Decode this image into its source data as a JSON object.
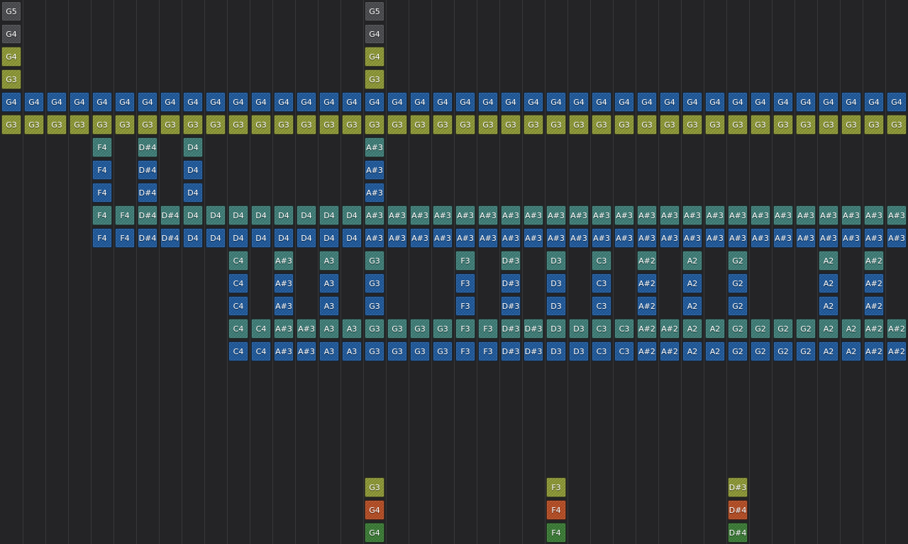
{
  "colors": {
    "background": "#242426",
    "grid_line": "#38383a",
    "blue": "#1f5a9e",
    "yellow": "#8f9a36",
    "teal": "#3f7f79",
    "gray": "#4a4b4f",
    "orange": "#b84e24",
    "green": "#3b7d36"
  },
  "columns": 40,
  "rows": 24,
  "runs": [
    {
      "row": 0,
      "start": 0,
      "color": "gray",
      "labels": [
        "G5"
      ]
    },
    {
      "row": 0,
      "start": 16,
      "color": "gray",
      "labels": [
        "G5"
      ]
    },
    {
      "row": 1,
      "start": 0,
      "color": "gray",
      "labels": [
        "G4"
      ]
    },
    {
      "row": 1,
      "start": 16,
      "color": "gray",
      "labels": [
        "G4"
      ]
    },
    {
      "row": 2,
      "start": 0,
      "color": "yellow",
      "labels": [
        "G4"
      ]
    },
    {
      "row": 2,
      "start": 16,
      "color": "yellow",
      "labels": [
        "G4"
      ]
    },
    {
      "row": 3,
      "start": 0,
      "color": "yellow",
      "labels": [
        "G3"
      ]
    },
    {
      "row": 3,
      "start": 16,
      "color": "yellow",
      "labels": [
        "G3"
      ]
    },
    {
      "row": 4,
      "start": 0,
      "color": "blue",
      "labels": [
        "G4",
        "G4",
        "G4",
        "G4",
        "G4",
        "G4",
        "G4",
        "G4",
        "G4",
        "G4",
        "G4",
        "G4",
        "G4",
        "G4",
        "G4",
        "G4",
        "G4",
        "G4",
        "G4",
        "G4",
        "G4",
        "G4",
        "G4",
        "G4",
        "G4",
        "G4",
        "G4",
        "G4",
        "G4",
        "G4",
        "G4",
        "G4",
        "G4",
        "G4",
        "G4",
        "G4",
        "G4",
        "G4",
        "G4",
        "G4"
      ]
    },
    {
      "row": 5,
      "start": 0,
      "color": "yellow",
      "labels": [
        "G3",
        "G3",
        "G3",
        "G3",
        "G3",
        "G3",
        "G3",
        "G3",
        "G3",
        "G3",
        "G3",
        "G3",
        "G3",
        "G3",
        "G3",
        "G3",
        "G3",
        "G3",
        "G3",
        "G3",
        "G3",
        "G3",
        "G3",
        "G3",
        "G3",
        "G3",
        "G3",
        "G3",
        "G3",
        "G3",
        "G3",
        "G3",
        "G3",
        "G3",
        "G3",
        "G3",
        "G3",
        "G3",
        "G3",
        "G3"
      ]
    },
    {
      "row": 6,
      "start": 4,
      "color": "teal",
      "labels": [
        "F4"
      ]
    },
    {
      "row": 6,
      "start": 6,
      "color": "teal",
      "labels": [
        "D#4"
      ]
    },
    {
      "row": 6,
      "start": 8,
      "color": "teal",
      "labels": [
        "D4"
      ]
    },
    {
      "row": 6,
      "start": 16,
      "color": "teal",
      "labels": [
        "A#3"
      ]
    },
    {
      "row": 7,
      "start": 4,
      "color": "blue",
      "labels": [
        "F4"
      ]
    },
    {
      "row": 7,
      "start": 6,
      "color": "blue",
      "labels": [
        "D#4"
      ]
    },
    {
      "row": 7,
      "start": 8,
      "color": "blue",
      "labels": [
        "D4"
      ]
    },
    {
      "row": 7,
      "start": 16,
      "color": "blue",
      "labels": [
        "A#3"
      ]
    },
    {
      "row": 8,
      "start": 4,
      "color": "blue",
      "labels": [
        "F4"
      ]
    },
    {
      "row": 8,
      "start": 6,
      "color": "blue",
      "labels": [
        "D#4"
      ]
    },
    {
      "row": 8,
      "start": 8,
      "color": "blue",
      "labels": [
        "D4"
      ]
    },
    {
      "row": 8,
      "start": 16,
      "color": "blue",
      "labels": [
        "A#3"
      ]
    },
    {
      "row": 9,
      "start": 4,
      "color": "teal",
      "labels": [
        "F4",
        "F4",
        "D#4",
        "D#4",
        "D4",
        "D4",
        "D4",
        "D4",
        "D4",
        "D4",
        "D4",
        "D4",
        "A#3",
        "A#3",
        "A#3",
        "A#3",
        "A#3",
        "A#3",
        "A#3",
        "A#3",
        "A#3",
        "A#3",
        "A#3",
        "A#3",
        "A#3",
        "A#3",
        "A#3",
        "A#3",
        "A#3",
        "A#3",
        "A#3",
        "A#3",
        "A#3",
        "A#3",
        "A#3",
        "A#3"
      ]
    },
    {
      "row": 10,
      "start": 4,
      "color": "blue",
      "labels": [
        "F4",
        "F4",
        "D#4",
        "D#4",
        "D4",
        "D4",
        "D4",
        "D4",
        "D4",
        "D4",
        "D4",
        "D4",
        "A#3",
        "A#3",
        "A#3",
        "A#3",
        "A#3",
        "A#3",
        "A#3",
        "A#3",
        "A#3",
        "A#3",
        "A#3",
        "A#3",
        "A#3",
        "A#3",
        "A#3",
        "A#3",
        "A#3",
        "A#3",
        "A#3",
        "A#3",
        "A#3",
        "A#3",
        "A#3",
        "A#3"
      ]
    },
    {
      "row": 11,
      "start": 10,
      "color": "teal",
      "labels": [
        "C4"
      ]
    },
    {
      "row": 11,
      "start": 12,
      "color": "teal",
      "labels": [
        "A#3"
      ]
    },
    {
      "row": 11,
      "start": 14,
      "color": "teal",
      "labels": [
        "A3"
      ]
    },
    {
      "row": 11,
      "start": 16,
      "color": "teal",
      "labels": [
        "G3"
      ]
    },
    {
      "row": 11,
      "start": 20,
      "color": "teal",
      "labels": [
        "F3"
      ]
    },
    {
      "row": 11,
      "start": 22,
      "color": "teal",
      "labels": [
        "D#3"
      ]
    },
    {
      "row": 11,
      "start": 24,
      "color": "teal",
      "labels": [
        "D3"
      ]
    },
    {
      "row": 11,
      "start": 26,
      "color": "teal",
      "labels": [
        "C3"
      ]
    },
    {
      "row": 11,
      "start": 28,
      "color": "teal",
      "labels": [
        "A#2"
      ]
    },
    {
      "row": 11,
      "start": 30,
      "color": "teal",
      "labels": [
        "A2"
      ]
    },
    {
      "row": 11,
      "start": 32,
      "color": "teal",
      "labels": [
        "G2"
      ]
    },
    {
      "row": 11,
      "start": 36,
      "color": "teal",
      "labels": [
        "A2"
      ]
    },
    {
      "row": 11,
      "start": 38,
      "color": "teal",
      "labels": [
        "A#2"
      ]
    },
    {
      "row": 12,
      "start": 10,
      "color": "blue",
      "labels": [
        "C4"
      ]
    },
    {
      "row": 12,
      "start": 12,
      "color": "blue",
      "labels": [
        "A#3"
      ]
    },
    {
      "row": 12,
      "start": 14,
      "color": "blue",
      "labels": [
        "A3"
      ]
    },
    {
      "row": 12,
      "start": 16,
      "color": "blue",
      "labels": [
        "G3"
      ]
    },
    {
      "row": 12,
      "start": 20,
      "color": "blue",
      "labels": [
        "F3"
      ]
    },
    {
      "row": 12,
      "start": 22,
      "color": "blue",
      "labels": [
        "D#3"
      ]
    },
    {
      "row": 12,
      "start": 24,
      "color": "blue",
      "labels": [
        "D3"
      ]
    },
    {
      "row": 12,
      "start": 26,
      "color": "blue",
      "labels": [
        "C3"
      ]
    },
    {
      "row": 12,
      "start": 28,
      "color": "blue",
      "labels": [
        "A#2"
      ]
    },
    {
      "row": 12,
      "start": 30,
      "color": "blue",
      "labels": [
        "A2"
      ]
    },
    {
      "row": 12,
      "start": 32,
      "color": "blue",
      "labels": [
        "G2"
      ]
    },
    {
      "row": 12,
      "start": 36,
      "color": "blue",
      "labels": [
        "A2"
      ]
    },
    {
      "row": 12,
      "start": 38,
      "color": "blue",
      "labels": [
        "A#2"
      ]
    },
    {
      "row": 13,
      "start": 10,
      "color": "blue",
      "labels": [
        "C4"
      ]
    },
    {
      "row": 13,
      "start": 12,
      "color": "blue",
      "labels": [
        "A#3"
      ]
    },
    {
      "row": 13,
      "start": 14,
      "color": "blue",
      "labels": [
        "A3"
      ]
    },
    {
      "row": 13,
      "start": 16,
      "color": "blue",
      "labels": [
        "G3"
      ]
    },
    {
      "row": 13,
      "start": 20,
      "color": "blue",
      "labels": [
        "F3"
      ]
    },
    {
      "row": 13,
      "start": 22,
      "color": "blue",
      "labels": [
        "D#3"
      ]
    },
    {
      "row": 13,
      "start": 24,
      "color": "blue",
      "labels": [
        "D3"
      ]
    },
    {
      "row": 13,
      "start": 26,
      "color": "blue",
      "labels": [
        "C3"
      ]
    },
    {
      "row": 13,
      "start": 28,
      "color": "blue",
      "labels": [
        "A#2"
      ]
    },
    {
      "row": 13,
      "start": 30,
      "color": "blue",
      "labels": [
        "A2"
      ]
    },
    {
      "row": 13,
      "start": 32,
      "color": "blue",
      "labels": [
        "G2"
      ]
    },
    {
      "row": 13,
      "start": 36,
      "color": "blue",
      "labels": [
        "A2"
      ]
    },
    {
      "row": 13,
      "start": 38,
      "color": "blue",
      "labels": [
        "A#2"
      ]
    },
    {
      "row": 14,
      "start": 10,
      "color": "teal",
      "labels": [
        "C4",
        "C4",
        "A#3",
        "A#3",
        "A3",
        "A3",
        "G3",
        "G3",
        "G3",
        "G3",
        "F3",
        "F3",
        "D#3",
        "D#3",
        "D3",
        "D3",
        "C3",
        "C3",
        "A#2",
        "A#2",
        "A2",
        "A2",
        "G2",
        "G2",
        "G2",
        "G2",
        "A2",
        "A2",
        "A#2",
        "A#2"
      ]
    },
    {
      "row": 15,
      "start": 10,
      "color": "blue",
      "labels": [
        "C4",
        "C4",
        "A#3",
        "A#3",
        "A3",
        "A3",
        "G3",
        "G3",
        "G3",
        "G3",
        "F3",
        "F3",
        "D#3",
        "D#3",
        "D3",
        "D3",
        "C3",
        "C3",
        "A#2",
        "A#2",
        "A2",
        "A2",
        "G2",
        "G2",
        "G2",
        "G2",
        "A2",
        "A2",
        "A#2",
        "A#2"
      ]
    },
    {
      "row": 21,
      "start": 16,
      "color": "yellow",
      "labels": [
        "G3"
      ]
    },
    {
      "row": 21,
      "start": 24,
      "color": "yellow",
      "labels": [
        "F3"
      ]
    },
    {
      "row": 21,
      "start": 32,
      "color": "yellow",
      "labels": [
        "D#3"
      ]
    },
    {
      "row": 22,
      "start": 16,
      "color": "orange",
      "labels": [
        "G4"
      ]
    },
    {
      "row": 22,
      "start": 24,
      "color": "orange",
      "labels": [
        "F4"
      ]
    },
    {
      "row": 22,
      "start": 32,
      "color": "orange",
      "labels": [
        "D#4"
      ]
    },
    {
      "row": 23,
      "start": 16,
      "color": "green",
      "labels": [
        "G4"
      ]
    },
    {
      "row": 23,
      "start": 24,
      "color": "green",
      "labels": [
        "F4"
      ]
    },
    {
      "row": 23,
      "start": 32,
      "color": "green",
      "labels": [
        "D#4"
      ]
    }
  ]
}
